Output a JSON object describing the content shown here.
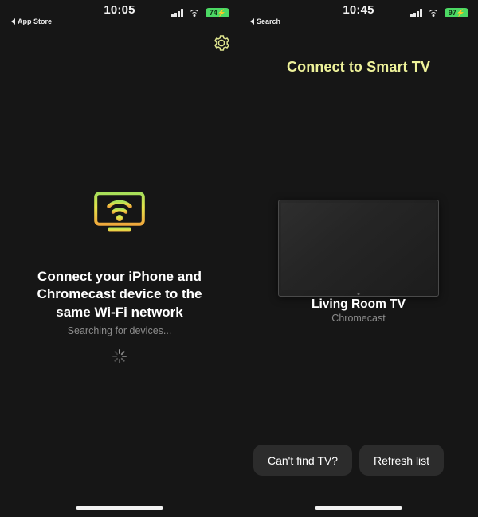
{
  "status_bars": {
    "left": {
      "time": "10:05",
      "back_label": "App Store",
      "battery": "74",
      "charging_glyph": "⚡",
      "battery_color": "#4cd964",
      "signal_icon": "cellular-signal-icon",
      "wifi_icon": "wifi-icon"
    },
    "right": {
      "time": "10:45",
      "back_label": "Search",
      "battery": "97",
      "charging_glyph": "⚡",
      "battery_color": "#4cd964",
      "signal_icon": "cellular-signal-icon",
      "wifi_icon": "wifi-icon"
    }
  },
  "header": {
    "title": "Connect to Smart TV",
    "title_color": "#eef29a",
    "settings_icon": "gear-icon"
  },
  "left_panel": {
    "cast_icon": "cast-tv-wifi-icon",
    "heading": "Connect your iPhone and Chromecast device to the same Wi-Fi network",
    "status_text": "Searching for devices...",
    "spinner_icon": "loading-spinner-icon"
  },
  "right_panel": {
    "device": {
      "image_icon": "tv-thumbnail",
      "name": "Living Room TV",
      "type": "Chromecast"
    },
    "buttons": [
      {
        "label": "Can't find TV?",
        "name": "cant-find-tv-button"
      },
      {
        "label": "Refresh list",
        "name": "refresh-list-button"
      }
    ]
  },
  "home_indicators": {
    "left": "home-indicator",
    "right": "home-indicator"
  }
}
